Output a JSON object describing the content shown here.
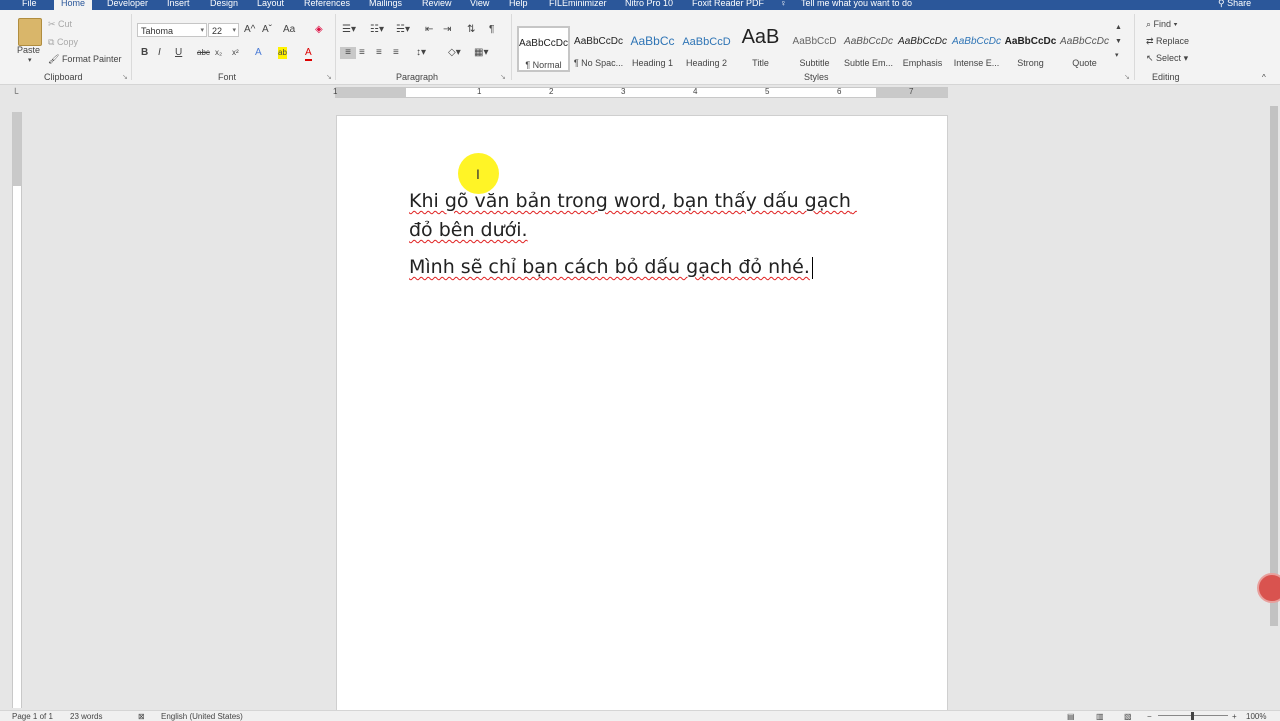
{
  "tabs": [
    {
      "label": "File"
    },
    {
      "label": "Home"
    },
    {
      "label": "Developer"
    },
    {
      "label": "Insert"
    },
    {
      "label": "Design"
    },
    {
      "label": "Layout"
    },
    {
      "label": "References"
    },
    {
      "label": "Mailings"
    },
    {
      "label": "Review"
    },
    {
      "label": "View"
    },
    {
      "label": "Help"
    },
    {
      "label": "FILEminimizer"
    },
    {
      "label": "Nitro Pro 10"
    },
    {
      "label": "Foxit Reader PDF"
    }
  ],
  "tell_me": "Tell me what you want to do",
  "share": "Share",
  "clipboard": {
    "paste": "Paste",
    "cut": "Cut",
    "copy": "Copy",
    "format_painter": "Format Painter",
    "label": "Clipboard"
  },
  "font": {
    "name": "Tahoma",
    "size": "22",
    "label": "Font",
    "bold": "B",
    "italic": "I",
    "underline": "U",
    "strike": "abc",
    "subscript": "x₂",
    "superscript": "x²",
    "grow": "A^",
    "shrink": "Aˇ",
    "change_case": "Aa",
    "effects": "A",
    "highlight": "ab",
    "color": "A"
  },
  "paragraph": {
    "label": "Paragraph",
    "show_marks": "¶"
  },
  "styles": {
    "label": "Styles",
    "items": [
      {
        "preview": "AaBbCcDc",
        "name": "¶ Normal"
      },
      {
        "preview": "AaBbCcDc",
        "name": "¶ No Spac..."
      },
      {
        "preview": "AaBbCc",
        "name": "Heading 1"
      },
      {
        "preview": "AaBbCcD",
        "name": "Heading 2"
      },
      {
        "preview": "AaB",
        "name": "Title"
      },
      {
        "preview": "AaBbCcD",
        "name": "Subtitle"
      },
      {
        "preview": "AaBbCcDc",
        "name": "Subtle Em..."
      },
      {
        "preview": "AaBbCcDc",
        "name": "Emphasis"
      },
      {
        "preview": "AaBbCcDc",
        "name": "Intense E..."
      },
      {
        "preview": "AaBbCcDc",
        "name": "Strong"
      },
      {
        "preview": "AaBbCcDc",
        "name": "Quote"
      }
    ]
  },
  "editing": {
    "label": "Editing",
    "find": "Find",
    "replace": "Replace",
    "select": "Select"
  },
  "document": {
    "paragraphs": [
      "Khi gõ văn bản trong word, bạn thấy dấu gạch đỏ bên dưới.",
      "Mình sẽ chỉ bạn cách bỏ dấu gạch đỏ nhé."
    ]
  },
  "ruler": {
    "numbers": [
      "1",
      "1",
      "2",
      "3",
      "4",
      "5",
      "6",
      "7"
    ]
  },
  "status": {
    "page": "Page 1 of 1",
    "words": "23 words",
    "language": "English (United States)",
    "zoom": "100%"
  }
}
